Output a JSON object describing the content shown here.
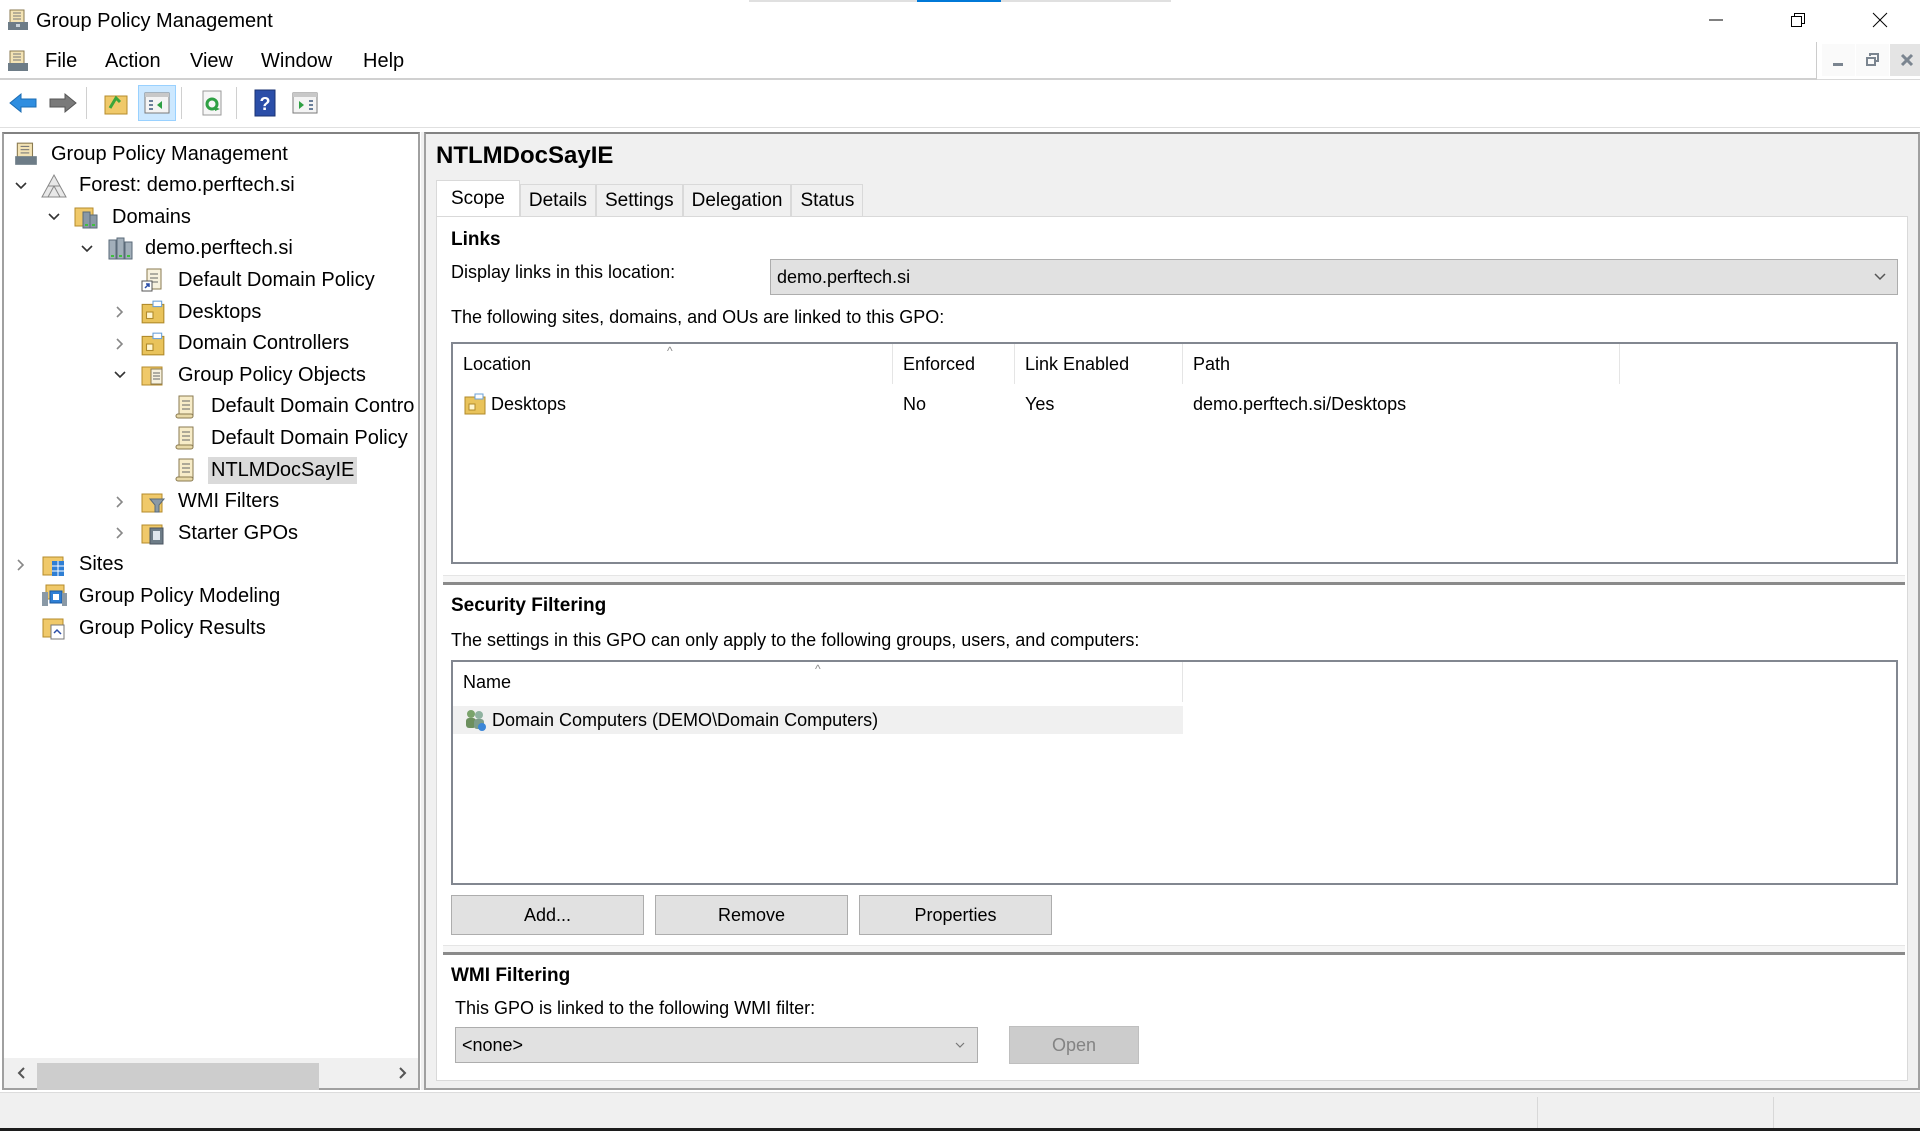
{
  "window": {
    "title": "Group Policy Management",
    "controls": {
      "minimize": "minimize",
      "restore": "restore",
      "close": "close"
    }
  },
  "menubar": {
    "items": [
      "File",
      "Action",
      "View",
      "Window",
      "Help"
    ]
  },
  "toolbar": {
    "buttons": [
      {
        "name": "back",
        "icon": "back-arrow-icon"
      },
      {
        "name": "forward",
        "icon": "forward-arrow-icon"
      },
      {
        "name": "up-one-level",
        "icon": "folder-up-icon"
      },
      {
        "name": "show-hide-console-tree",
        "icon": "console-tree-icon",
        "pressed": true
      },
      {
        "name": "refresh",
        "icon": "refresh-icon"
      },
      {
        "name": "help",
        "icon": "help-icon"
      },
      {
        "name": "show-hide-action-pane",
        "icon": "action-pane-icon"
      }
    ]
  },
  "tree": {
    "items": [
      {
        "label": "Group Policy Management",
        "level": 0,
        "expander": "none",
        "icon": "gpm-root-icon"
      },
      {
        "label": "Forest: demo.perftech.si",
        "level": 1,
        "expander": "expanded",
        "icon": "forest-icon"
      },
      {
        "label": "Domains",
        "level": 2,
        "expander": "expanded",
        "icon": "domains-icon"
      },
      {
        "label": "demo.perftech.si",
        "level": 3,
        "expander": "expanded",
        "icon": "domain-icon"
      },
      {
        "label": "Default Domain Policy",
        "level": 4,
        "expander": "none",
        "icon": "gpo-link-icon"
      },
      {
        "label": "Desktops",
        "level": 4,
        "expander": "collapsed",
        "icon": "ou-icon"
      },
      {
        "label": "Domain Controllers",
        "level": 4,
        "expander": "collapsed",
        "icon": "ou-icon"
      },
      {
        "label": "Group Policy Objects",
        "level": 4,
        "expander": "expanded",
        "icon": "gpo-folder-icon"
      },
      {
        "label": "Default Domain Contro",
        "level": 5,
        "expander": "none",
        "icon": "gpo-icon"
      },
      {
        "label": "Default Domain Policy",
        "level": 5,
        "expander": "none",
        "icon": "gpo-icon"
      },
      {
        "label": "NTLMDocSayIE",
        "level": 5,
        "expander": "none",
        "icon": "gpo-icon",
        "selected": true
      },
      {
        "label": "WMI Filters",
        "level": 4,
        "expander": "collapsed",
        "icon": "wmi-filter-folder-icon"
      },
      {
        "label": "Starter GPOs",
        "level": 4,
        "expander": "collapsed",
        "icon": "starter-gpo-folder-icon"
      },
      {
        "label": "Sites",
        "level": 1,
        "expander": "collapsed",
        "icon": "sites-icon"
      },
      {
        "label": "Group Policy Modeling",
        "level": 1,
        "expander": "none",
        "icon": "modeling-icon"
      },
      {
        "label": "Group Policy Results",
        "level": 1,
        "expander": "none",
        "icon": "results-icon"
      }
    ]
  },
  "details": {
    "gpo_name": "NTLMDocSayIE",
    "tabs": [
      {
        "label": "Scope",
        "active": true
      },
      {
        "label": "Details"
      },
      {
        "label": "Settings"
      },
      {
        "label": "Delegation"
      },
      {
        "label": "Status"
      }
    ],
    "links": {
      "title": "Links",
      "location_label": "Display links in this location:",
      "location_value": "demo.perftech.si",
      "description": "The following sites, domains, and OUs are linked to this GPO:",
      "columns": [
        "Location",
        "Enforced",
        "Link Enabled",
        "Path"
      ],
      "rows": [
        {
          "location": "Desktops",
          "enforced": "No",
          "link_enabled": "Yes",
          "path": "demo.perftech.si/Desktops"
        }
      ]
    },
    "security_filtering": {
      "title": "Security Filtering",
      "description": "The settings in this GPO can only apply to the following groups, users, and computers:",
      "columns": [
        "Name"
      ],
      "rows": [
        {
          "name": "Domain Computers (DEMO\\Domain Computers)"
        }
      ],
      "buttons": {
        "add": "Add...",
        "remove": "Remove",
        "properties": "Properties"
      }
    },
    "wmi_filtering": {
      "title": "WMI Filtering",
      "description": "This GPO is linked to the following WMI filter:",
      "filter_value": "<none>",
      "open_button": "Open",
      "open_enabled": false
    }
  },
  "colors": {
    "accent": "#0078d7",
    "selection": "#dadada",
    "button_face": "#e1e1e1",
    "disabled_button": "#cccccc"
  }
}
